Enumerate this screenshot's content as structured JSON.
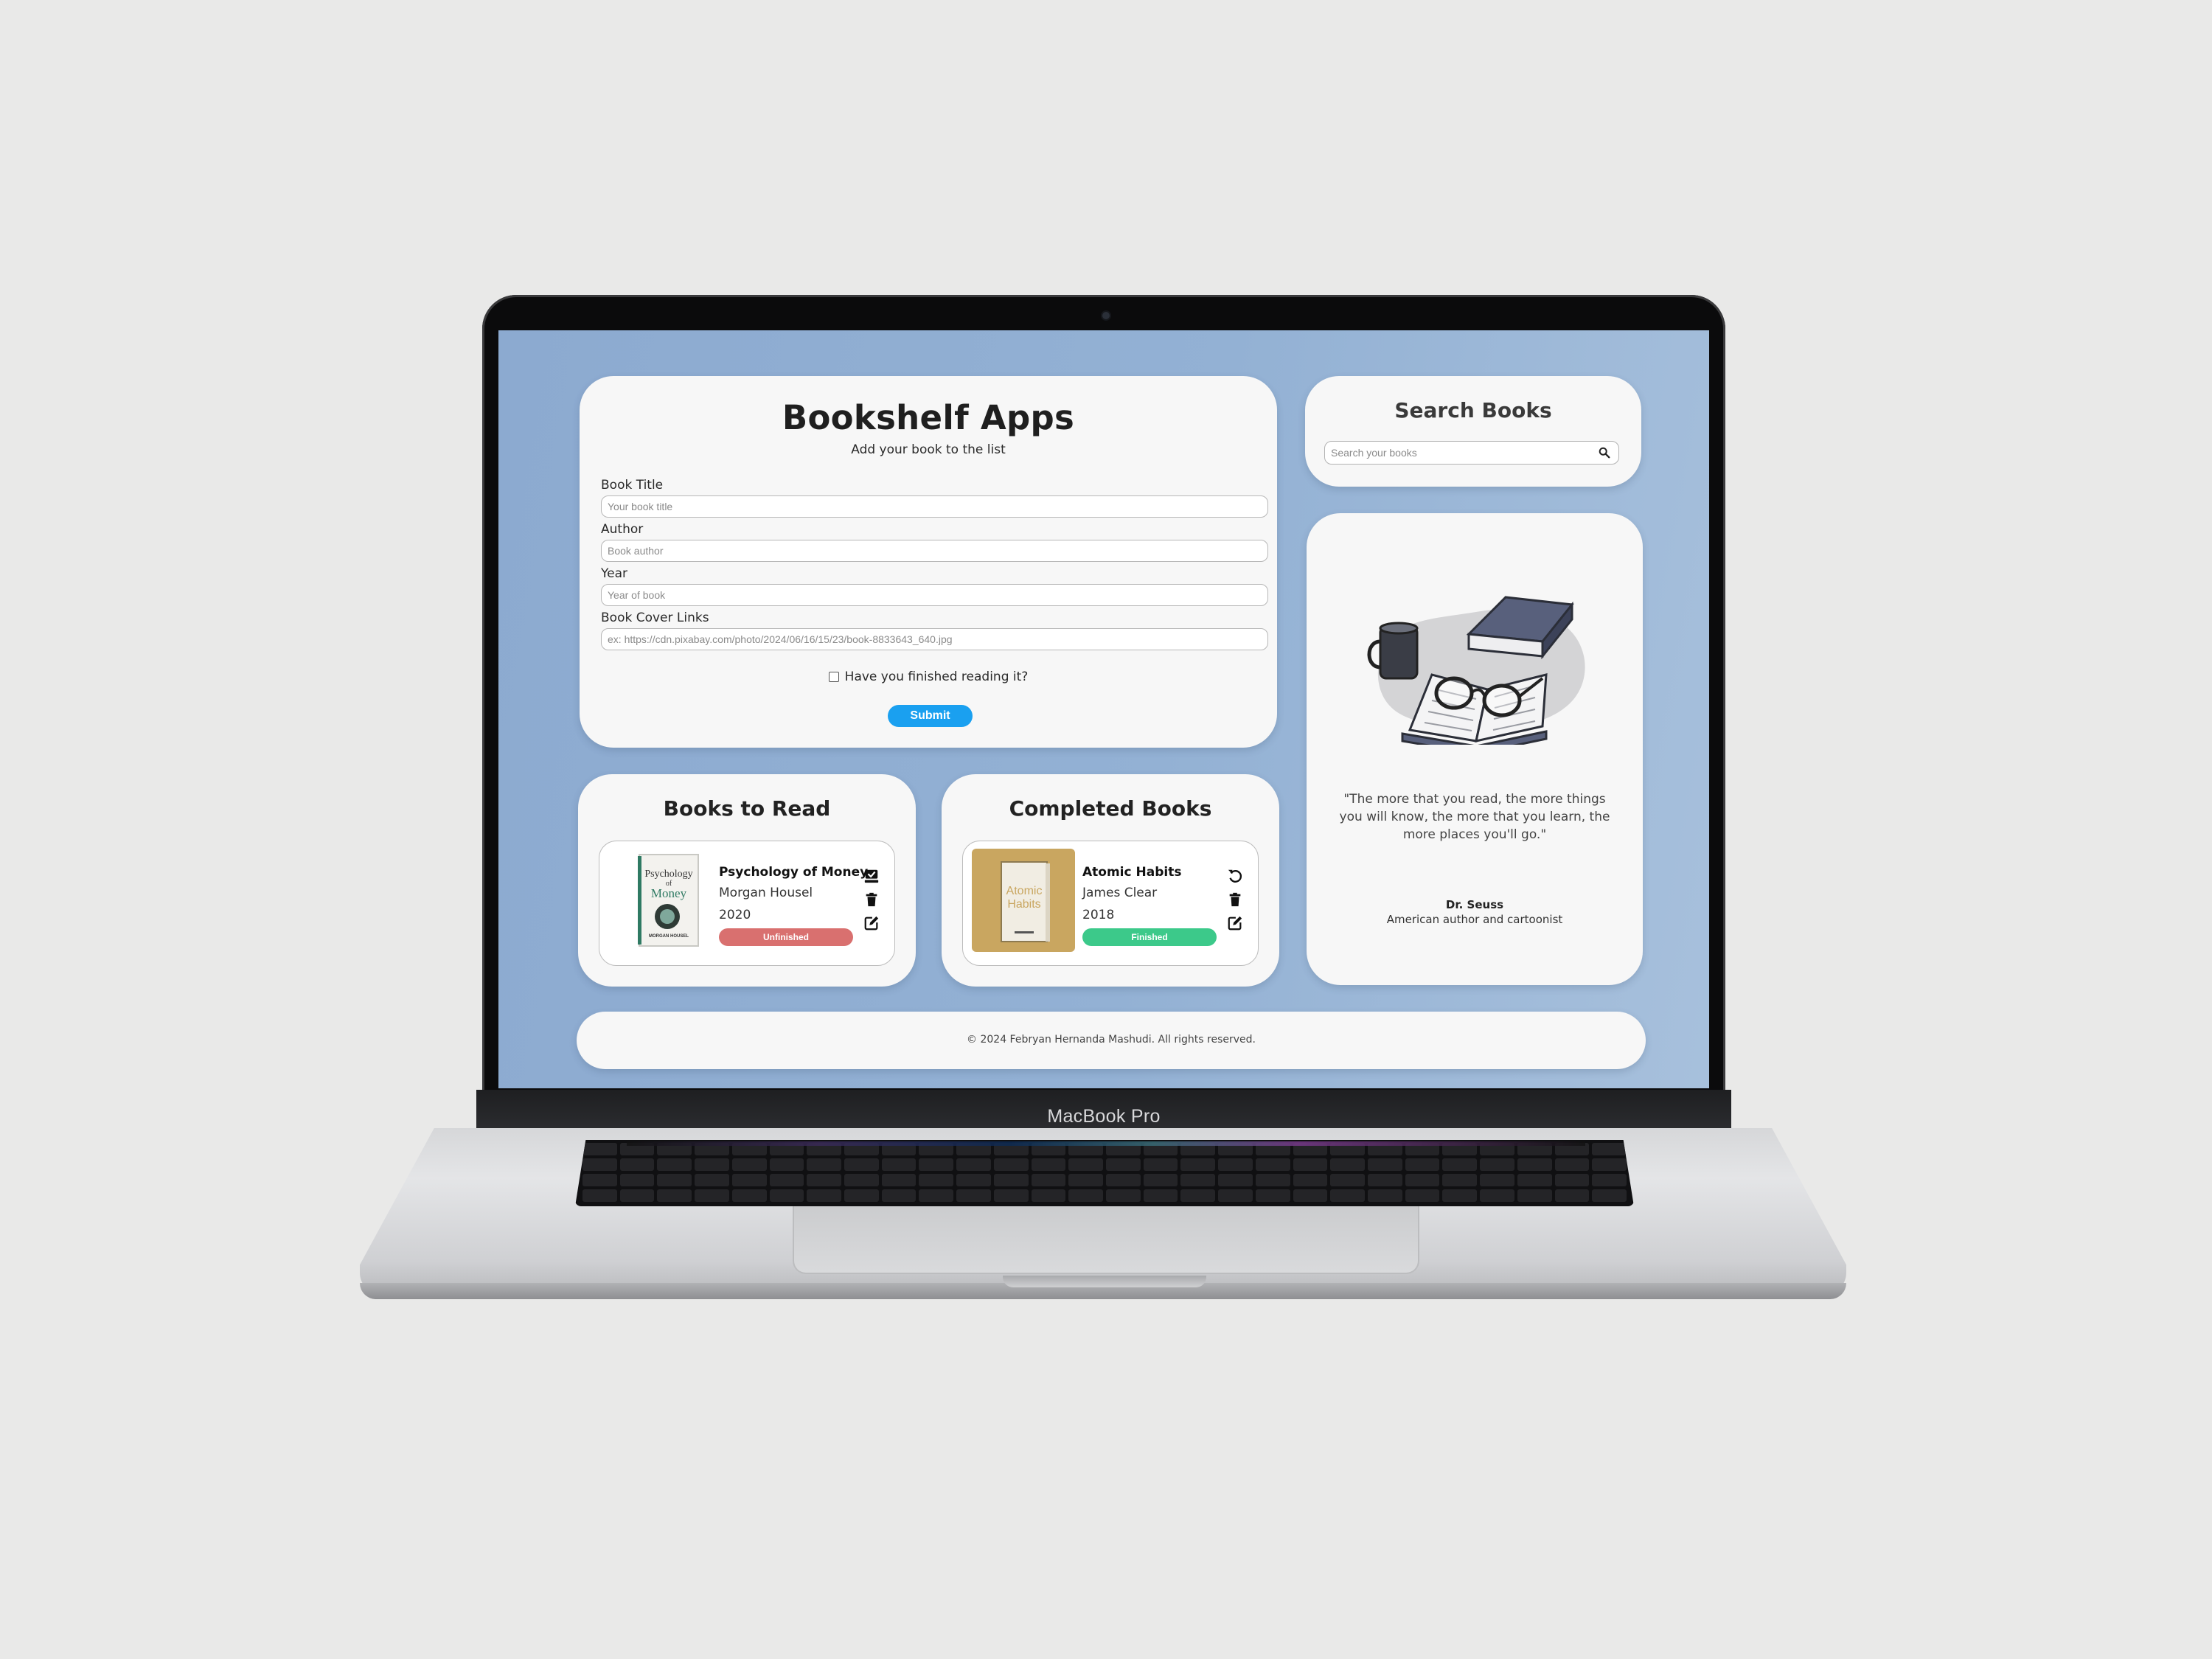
{
  "device": {
    "label": "MacBook Pro"
  },
  "form": {
    "title": "Bookshelf Apps",
    "subtitle": "Add your book to the list",
    "fields": [
      {
        "label": "Book Title",
        "placeholder": "Your book title"
      },
      {
        "label": "Author",
        "placeholder": "Book author"
      },
      {
        "label": "Year",
        "placeholder": "Year of book"
      },
      {
        "label": "Book Cover Links",
        "placeholder": "ex: https://cdn.pixabay.com/photo/2024/06/16/15/23/book-8833643_640.jpg"
      }
    ],
    "checkbox_label": "Have you finished reading it?",
    "checkbox_checked": false,
    "submit_label": "Submit"
  },
  "search": {
    "title": "Search Books",
    "placeholder": "Search your books"
  },
  "quote": {
    "text": "\"The more that you read, the more things you will know, the more that you learn, the more places you'll go.\"",
    "author": "Dr. Seuss",
    "role": "American author and cartoonist"
  },
  "shelves": {
    "to_read": {
      "title": "Books to Read",
      "books": [
        {
          "title": "Psychology of Money",
          "author": "Morgan Housel",
          "year": "2020",
          "status": "Unfinished",
          "status_color": "#d9706f",
          "cover_words": [
            "Psychology",
            "of",
            "Money"
          ],
          "cover_author": "MORGAN HOUSEL"
        }
      ]
    },
    "completed": {
      "title": "Completed Books",
      "books": [
        {
          "title": "Atomic Habits",
          "author": "James Clear",
          "year": "2018",
          "status": "Finished",
          "status_color": "#3cc98a",
          "cover_words": [
            "Atomic",
            "Habits"
          ]
        }
      ]
    }
  },
  "footer": {
    "text": "© 2024 Febryan Hernanda Mashudi. All rights reserved."
  },
  "colors": {
    "screen_bg": "#8caad0",
    "card_bg": "#f7f7f7",
    "accent": "#1aa0f0",
    "unfinished": "#d9706f",
    "finished": "#3cc98a"
  },
  "icons": [
    "search-icon",
    "check-read-icon",
    "undo-icon",
    "trash-icon",
    "edit-icon",
    "checkbox-icon"
  ]
}
